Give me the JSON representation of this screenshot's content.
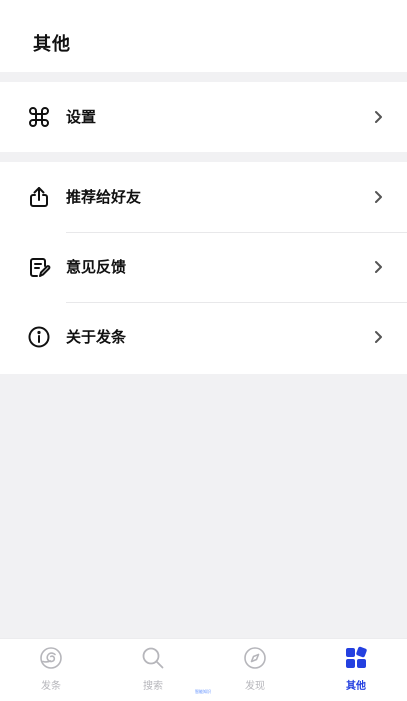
{
  "header": {
    "title": "其他"
  },
  "section1": {
    "items": [
      {
        "label": "设置",
        "icon": "command-icon"
      }
    ]
  },
  "section2": {
    "items": [
      {
        "label": "推荐给好友",
        "icon": "share-icon"
      },
      {
        "label": "意见反馈",
        "icon": "feedback-edit-icon"
      },
      {
        "label": "关于发条",
        "icon": "info-icon"
      }
    ]
  },
  "tabbar": {
    "tabs": [
      {
        "label": "发条",
        "icon": "app-logo-icon",
        "active": false
      },
      {
        "label": "搜索",
        "icon": "search-icon",
        "active": false
      },
      {
        "label": "发现",
        "icon": "compass-icon",
        "active": false
      },
      {
        "label": "其他",
        "icon": "apps-grid-icon",
        "active": true
      }
    ]
  },
  "colors": {
    "accent": "#2440e0",
    "inactive": "#b6b6bb",
    "background": "#f1f1f3"
  },
  "watermark": "智能知识"
}
